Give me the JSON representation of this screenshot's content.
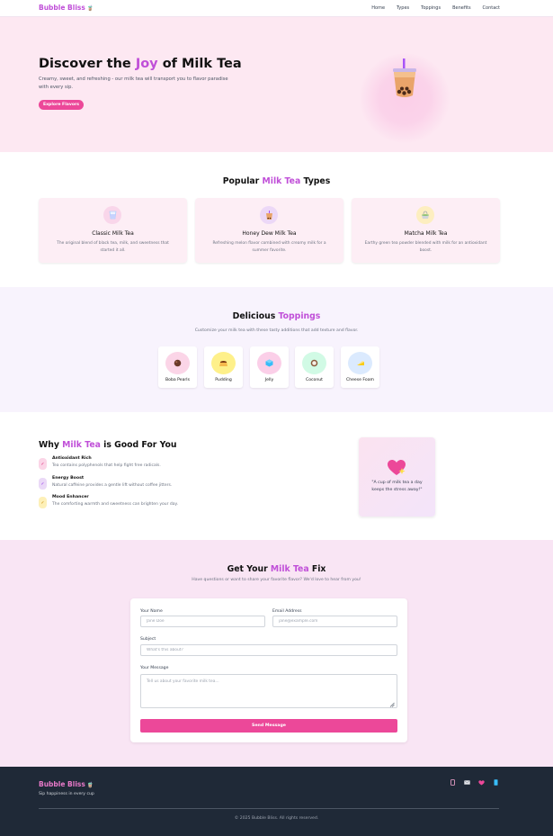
{
  "nav": {
    "logo": "Bubble Bliss",
    "links": [
      "Home",
      "Types",
      "Toppings",
      "Benefits",
      "Contact"
    ]
  },
  "hero": {
    "title_pre": "Discover the ",
    "title_hl": "Joy",
    "title_post": " of Milk Tea",
    "subtitle": "Creamy, sweet, and refreshing - our milk tea will transport you to flavor paradise with every sip.",
    "cta": "Explore Flavors"
  },
  "types": {
    "title_pre": "Popular ",
    "title_hl": "Milk Tea",
    "title_post": " Types",
    "cards": [
      {
        "title": "Classic Milk Tea",
        "desc": "The original blend of black tea, milk, and sweetness that started it all.",
        "icon": "cup-icon",
        "icon_bg": "#f9d6ea"
      },
      {
        "title": "Honey Dew Milk Tea",
        "desc": "Refreshing melon flavor combined with creamy milk for a summer favorite.",
        "icon": "bubble-tea-icon",
        "icon_bg": "#ecd8f7"
      },
      {
        "title": "Matcha Milk Tea",
        "desc": "Earthy green tea powder blended with milk for an antioxidant boost.",
        "icon": "matcha-icon",
        "icon_bg": "#fdeec0"
      }
    ]
  },
  "toppings": {
    "title_pre": "Delicious ",
    "title_hl": "Toppings",
    "subtitle": "Customize your milk tea with these tasty additions that add texture and flavor.",
    "items": [
      {
        "label": "Boba Pearls",
        "icon": "boba-icon",
        "bg": "#fbd5e7"
      },
      {
        "label": "Pudding",
        "icon": "pudding-icon",
        "bg": "#fef08a"
      },
      {
        "label": "Jelly",
        "icon": "jelly-icon",
        "bg": "#fbcfe8"
      },
      {
        "label": "Coconut",
        "icon": "coconut-icon",
        "bg": "#d1fae5"
      },
      {
        "label": "Cheese Foam",
        "icon": "cheese-icon",
        "bg": "#dbeafe"
      }
    ]
  },
  "why": {
    "title_pre": "Why ",
    "title_hl": "Milk Tea",
    "title_post": " is Good For You",
    "benefits": [
      {
        "title": "Antioxidant Rich",
        "desc": "Tea contains polyphenols that help fight free radicals.",
        "bg": "#fbd5e7",
        "color": "#db2777"
      },
      {
        "title": "Energy Boost",
        "desc": "Natural caffeine provides a gentle lift without coffee jitters.",
        "bg": "#ead9f7",
        "color": "#9333ea"
      },
      {
        "title": "Mood Enhancer",
        "desc": "The comforting warmth and sweetness can brighten your day.",
        "bg": "#fdf0b8",
        "color": "#ca8a04"
      }
    ],
    "quote": "\"A cup of milk tea a day keeps the stress away!\""
  },
  "contact": {
    "title_pre": "Get Your ",
    "title_hl": "Milk Tea",
    "title_post": " Fix",
    "subtitle": "Have questions or want to share your favorite flavor? We'd love to hear from you!",
    "name_label": "Your Name",
    "name_placeholder": "Jane Doe",
    "email_label": "Email Address",
    "email_placeholder": "jane@example.com",
    "subject_label": "Subject",
    "subject_placeholder": "What's this about?",
    "message_label": "Your Message",
    "message_placeholder": "Tell us about your favorite milk tea...",
    "submit": "Send Message"
  },
  "footer": {
    "logo": "Bubble Bliss",
    "tagline": "Sip happiness in every cup",
    "copyright": "© 2025 Bubble Bliss. All rights reserved."
  },
  "colors": {
    "accent": "#c04fd8",
    "pink": "#ec4899",
    "hero_bg": "#fde8f2",
    "footer_bg": "#1f2937"
  }
}
